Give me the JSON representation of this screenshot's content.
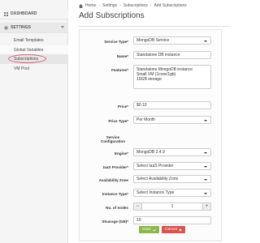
{
  "sidebar": {
    "dashboard": "DASHBOARD",
    "settings": "SETTINGS",
    "items": [
      {
        "label": "Email Templates"
      },
      {
        "label": "Global Variables"
      },
      {
        "label": "Subscriptions"
      },
      {
        "label": "VM Pool"
      }
    ]
  },
  "breadcrumb": {
    "home": "Home",
    "settings": "Settings",
    "subscriptions": "Subscriptions",
    "current": "Add Subscriptions"
  },
  "page": {
    "title": "Add Subscriptions"
  },
  "form": {
    "service_type": {
      "label": "Service Type*",
      "value": "MongoDB Service"
    },
    "name": {
      "label": "Name*",
      "value": "Standalone DB instance"
    },
    "features": {
      "label": "Features*",
      "lines": [
        "Standalone MongoDB instance",
        "Small VM (1core/1gb)",
        "10GB storage"
      ]
    },
    "price": {
      "label": "Price*",
      "value": "$0.10"
    },
    "price_type": {
      "label": "Price Type*",
      "value": "Per Month"
    },
    "service_config": {
      "label_line1": "Service",
      "label_line2": "Configuration"
    },
    "engine": {
      "label": "Engine*",
      "value": "MongoDB 2.4.9"
    },
    "iaas_provider": {
      "label": "IaaS Provider*",
      "value": "Select IaaS Provider"
    },
    "availability_zone": {
      "label": "Availability Zone",
      "value": "Select Availability Zone"
    },
    "instance_type": {
      "label": "Instance Type*",
      "value": "Select Instance Type"
    },
    "nodes": {
      "label": "No. of nodes",
      "value": "1",
      "minus": "−",
      "plus": "+"
    },
    "storage": {
      "label": "Stoarage (GB)*",
      "value": "10"
    },
    "save_label": "Save",
    "cancel_label": "Cancel"
  }
}
